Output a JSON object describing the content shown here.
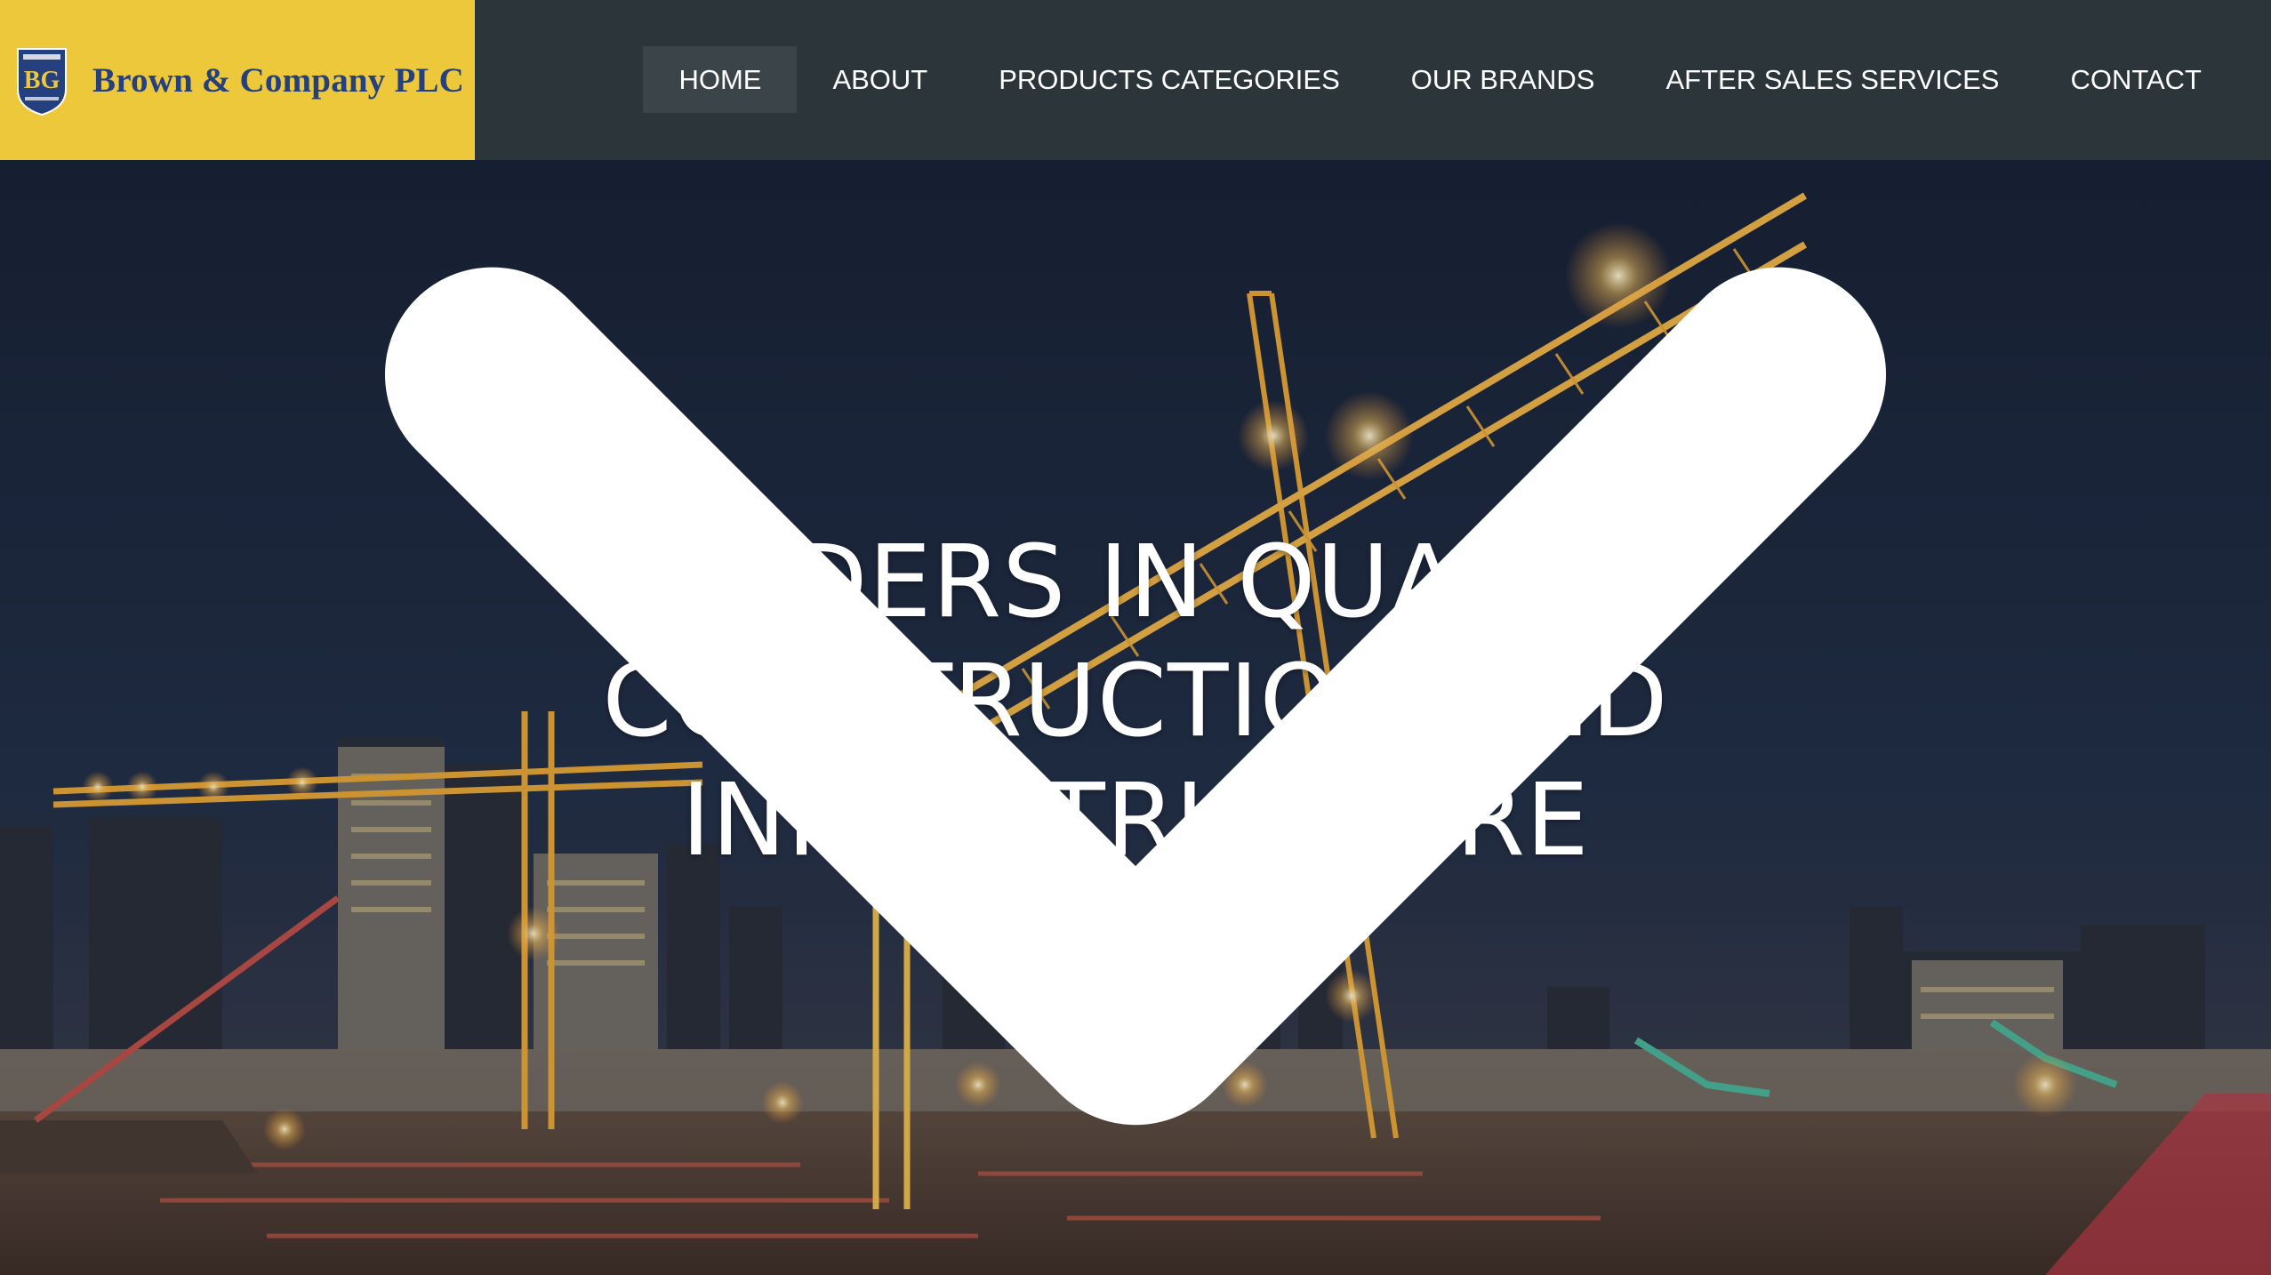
{
  "brand": {
    "crest_text": "BG",
    "name": "Brown & Company PLC",
    "colors": {
      "logo_bg": "#ecc83a",
      "logo_text": "#24407e",
      "header_bg": "#2c3539"
    }
  },
  "nav": {
    "items": [
      {
        "label": "HOME",
        "active": true
      },
      {
        "label": "ABOUT",
        "active": false
      },
      {
        "label": "PRODUCTS CATEGORIES",
        "active": false
      },
      {
        "label": "OUR BRANDS",
        "active": false
      },
      {
        "label": "AFTER SALES SERVICES",
        "active": false
      },
      {
        "label": "CONTACT",
        "active": false
      }
    ]
  },
  "hero": {
    "title": "LEADERS IN QUALITY\nCONSTRUCTION AND\nINFRASTRUCTURE",
    "scroll_icon": "chevron-down-icon",
    "image": "night-construction-site-cranes"
  }
}
